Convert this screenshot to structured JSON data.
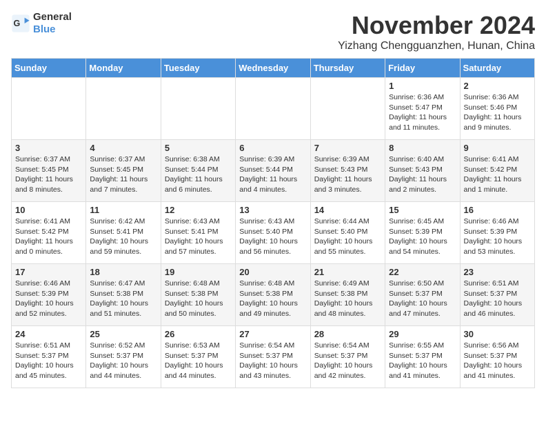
{
  "logo": {
    "text_general": "General",
    "text_blue": "Blue"
  },
  "header": {
    "month": "November 2024",
    "location": "Yizhang Chengguanzhen, Hunan, China"
  },
  "weekdays": [
    "Sunday",
    "Monday",
    "Tuesday",
    "Wednesday",
    "Thursday",
    "Friday",
    "Saturday"
  ],
  "weeks": [
    [
      {
        "day": "",
        "info": ""
      },
      {
        "day": "",
        "info": ""
      },
      {
        "day": "",
        "info": ""
      },
      {
        "day": "",
        "info": ""
      },
      {
        "day": "",
        "info": ""
      },
      {
        "day": "1",
        "info": "Sunrise: 6:36 AM\nSunset: 5:47 PM\nDaylight: 11 hours and 11 minutes."
      },
      {
        "day": "2",
        "info": "Sunrise: 6:36 AM\nSunset: 5:46 PM\nDaylight: 11 hours and 9 minutes."
      }
    ],
    [
      {
        "day": "3",
        "info": "Sunrise: 6:37 AM\nSunset: 5:45 PM\nDaylight: 11 hours and 8 minutes."
      },
      {
        "day": "4",
        "info": "Sunrise: 6:37 AM\nSunset: 5:45 PM\nDaylight: 11 hours and 7 minutes."
      },
      {
        "day": "5",
        "info": "Sunrise: 6:38 AM\nSunset: 5:44 PM\nDaylight: 11 hours and 6 minutes."
      },
      {
        "day": "6",
        "info": "Sunrise: 6:39 AM\nSunset: 5:44 PM\nDaylight: 11 hours and 4 minutes."
      },
      {
        "day": "7",
        "info": "Sunrise: 6:39 AM\nSunset: 5:43 PM\nDaylight: 11 hours and 3 minutes."
      },
      {
        "day": "8",
        "info": "Sunrise: 6:40 AM\nSunset: 5:43 PM\nDaylight: 11 hours and 2 minutes."
      },
      {
        "day": "9",
        "info": "Sunrise: 6:41 AM\nSunset: 5:42 PM\nDaylight: 11 hours and 1 minute."
      }
    ],
    [
      {
        "day": "10",
        "info": "Sunrise: 6:41 AM\nSunset: 5:42 PM\nDaylight: 11 hours and 0 minutes."
      },
      {
        "day": "11",
        "info": "Sunrise: 6:42 AM\nSunset: 5:41 PM\nDaylight: 10 hours and 59 minutes."
      },
      {
        "day": "12",
        "info": "Sunrise: 6:43 AM\nSunset: 5:41 PM\nDaylight: 10 hours and 57 minutes."
      },
      {
        "day": "13",
        "info": "Sunrise: 6:43 AM\nSunset: 5:40 PM\nDaylight: 10 hours and 56 minutes."
      },
      {
        "day": "14",
        "info": "Sunrise: 6:44 AM\nSunset: 5:40 PM\nDaylight: 10 hours and 55 minutes."
      },
      {
        "day": "15",
        "info": "Sunrise: 6:45 AM\nSunset: 5:39 PM\nDaylight: 10 hours and 54 minutes."
      },
      {
        "day": "16",
        "info": "Sunrise: 6:46 AM\nSunset: 5:39 PM\nDaylight: 10 hours and 53 minutes."
      }
    ],
    [
      {
        "day": "17",
        "info": "Sunrise: 6:46 AM\nSunset: 5:39 PM\nDaylight: 10 hours and 52 minutes."
      },
      {
        "day": "18",
        "info": "Sunrise: 6:47 AM\nSunset: 5:38 PM\nDaylight: 10 hours and 51 minutes."
      },
      {
        "day": "19",
        "info": "Sunrise: 6:48 AM\nSunset: 5:38 PM\nDaylight: 10 hours and 50 minutes."
      },
      {
        "day": "20",
        "info": "Sunrise: 6:48 AM\nSunset: 5:38 PM\nDaylight: 10 hours and 49 minutes."
      },
      {
        "day": "21",
        "info": "Sunrise: 6:49 AM\nSunset: 5:38 PM\nDaylight: 10 hours and 48 minutes."
      },
      {
        "day": "22",
        "info": "Sunrise: 6:50 AM\nSunset: 5:37 PM\nDaylight: 10 hours and 47 minutes."
      },
      {
        "day": "23",
        "info": "Sunrise: 6:51 AM\nSunset: 5:37 PM\nDaylight: 10 hours and 46 minutes."
      }
    ],
    [
      {
        "day": "24",
        "info": "Sunrise: 6:51 AM\nSunset: 5:37 PM\nDaylight: 10 hours and 45 minutes."
      },
      {
        "day": "25",
        "info": "Sunrise: 6:52 AM\nSunset: 5:37 PM\nDaylight: 10 hours and 44 minutes."
      },
      {
        "day": "26",
        "info": "Sunrise: 6:53 AM\nSunset: 5:37 PM\nDaylight: 10 hours and 44 minutes."
      },
      {
        "day": "27",
        "info": "Sunrise: 6:54 AM\nSunset: 5:37 PM\nDaylight: 10 hours and 43 minutes."
      },
      {
        "day": "28",
        "info": "Sunrise: 6:54 AM\nSunset: 5:37 PM\nDaylight: 10 hours and 42 minutes."
      },
      {
        "day": "29",
        "info": "Sunrise: 6:55 AM\nSunset: 5:37 PM\nDaylight: 10 hours and 41 minutes."
      },
      {
        "day": "30",
        "info": "Sunrise: 6:56 AM\nSunset: 5:37 PM\nDaylight: 10 hours and 41 minutes."
      }
    ]
  ]
}
